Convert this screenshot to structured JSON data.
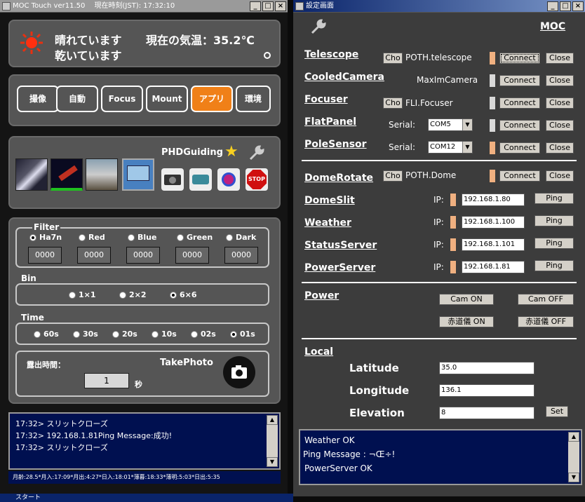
{
  "win1": {
    "title": "MOC Touch ver11.50　 現在時刻(JST):  17:32:10",
    "weather": {
      "line1": "晴れています",
      "line2": "乾いています",
      "temp": "現在の気温：35.2℃"
    },
    "menu": [
      "撮像",
      "自動",
      "Focus",
      "Mount",
      "アプリ",
      "環境"
    ],
    "apps": {
      "label": "PHDGuiding",
      "stop": "STOP"
    },
    "filter": {
      "label": "Filter",
      "options": [
        "Ha7n",
        "Red",
        "Blue",
        "Green",
        "Dark"
      ],
      "values": [
        "0000",
        "0000",
        "0000",
        "0000",
        "0000"
      ]
    },
    "bin": {
      "label": "Bin",
      "options": [
        "1×1",
        "2×2",
        "6×6"
      ]
    },
    "time": {
      "label": "Time",
      "options": [
        "60s",
        "30s",
        "20s",
        "10s",
        "02s",
        "01s"
      ]
    },
    "expose": {
      "label": "露出時間：",
      "take": "TakePhoto",
      "value": "1",
      "unit": "秒"
    },
    "log": [
      "17:32> スリットクローズ",
      "17:32> 192.168.1.81Ping Message:成功!",
      "17:32> スリットクローズ"
    ],
    "status": "月齢:28.5*月入:17:09*月出:4:27*日入:18:01*薄暮:18:33*薄明:5:03*日出:5:35",
    "taskbar": "スタート"
  },
  "win2": {
    "title": "設定画面",
    "brand": "MOC",
    "rows": {
      "telescope": {
        "label": "Telescope",
        "cho": "Cho",
        "driver": "POTH.telescope",
        "connect": "Connect",
        "close": "Close"
      },
      "camera": {
        "label": "CooledCamera",
        "driver": "MaxImCamera",
        "connect": "Connect",
        "close": "Close"
      },
      "focuser": {
        "label": "Focuser",
        "cho": "Cho",
        "driver": "FLI.Focuser",
        "connect": "Connect",
        "close": "Close"
      },
      "flatpanel": {
        "label": "FlatPanel",
        "serial": "Serial:",
        "port": "COM5",
        "connect": "Connect",
        "close": "Close"
      },
      "polesensor": {
        "label": "PoleSensor",
        "serial": "Serial:",
        "port": "COM12",
        "connect": "Connect",
        "close": "Close"
      },
      "domerotate": {
        "label": "DomeRotate",
        "cho": "Cho",
        "driver": "POTH.Dome",
        "connect": "Connect",
        "close": "Close"
      },
      "domeslit": {
        "label": "DomeSlit",
        "ip": "IP:",
        "value": "192.168.1.80",
        "ping": "Ping"
      },
      "weather": {
        "label": "Weather",
        "ip": "IP:",
        "value": "192.168.1.100",
        "ping": "Ping"
      },
      "statusserver": {
        "label": "StatusServer",
        "ip": "IP:",
        "value": "192.168.1.101",
        "ping": "Ping"
      },
      "powerserver": {
        "label": "PowerServer",
        "ip": "IP:",
        "value": "192.168.1.81",
        "ping": "Ping"
      }
    },
    "power": {
      "label": "Power",
      "cam_on": "Cam ON",
      "cam_off": "Cam OFF",
      "eq_on": "赤道儀 ON",
      "eq_off": "赤道儀 OFF"
    },
    "local": {
      "label": "Local",
      "lat_label": "Latitude",
      "lat": "35.0",
      "lon_label": "Longitude",
      "lon": "136.1",
      "elev_label": "Elevation",
      "elev": "8",
      "set": "Set"
    },
    "log": [
      "Weather OK",
      "Ping Message : ¬Œ÷!",
      "PowerServer OK"
    ]
  },
  "colors": {
    "accent": "#f08018",
    "indicator": "#f0b080",
    "log_bg": "#001050"
  }
}
